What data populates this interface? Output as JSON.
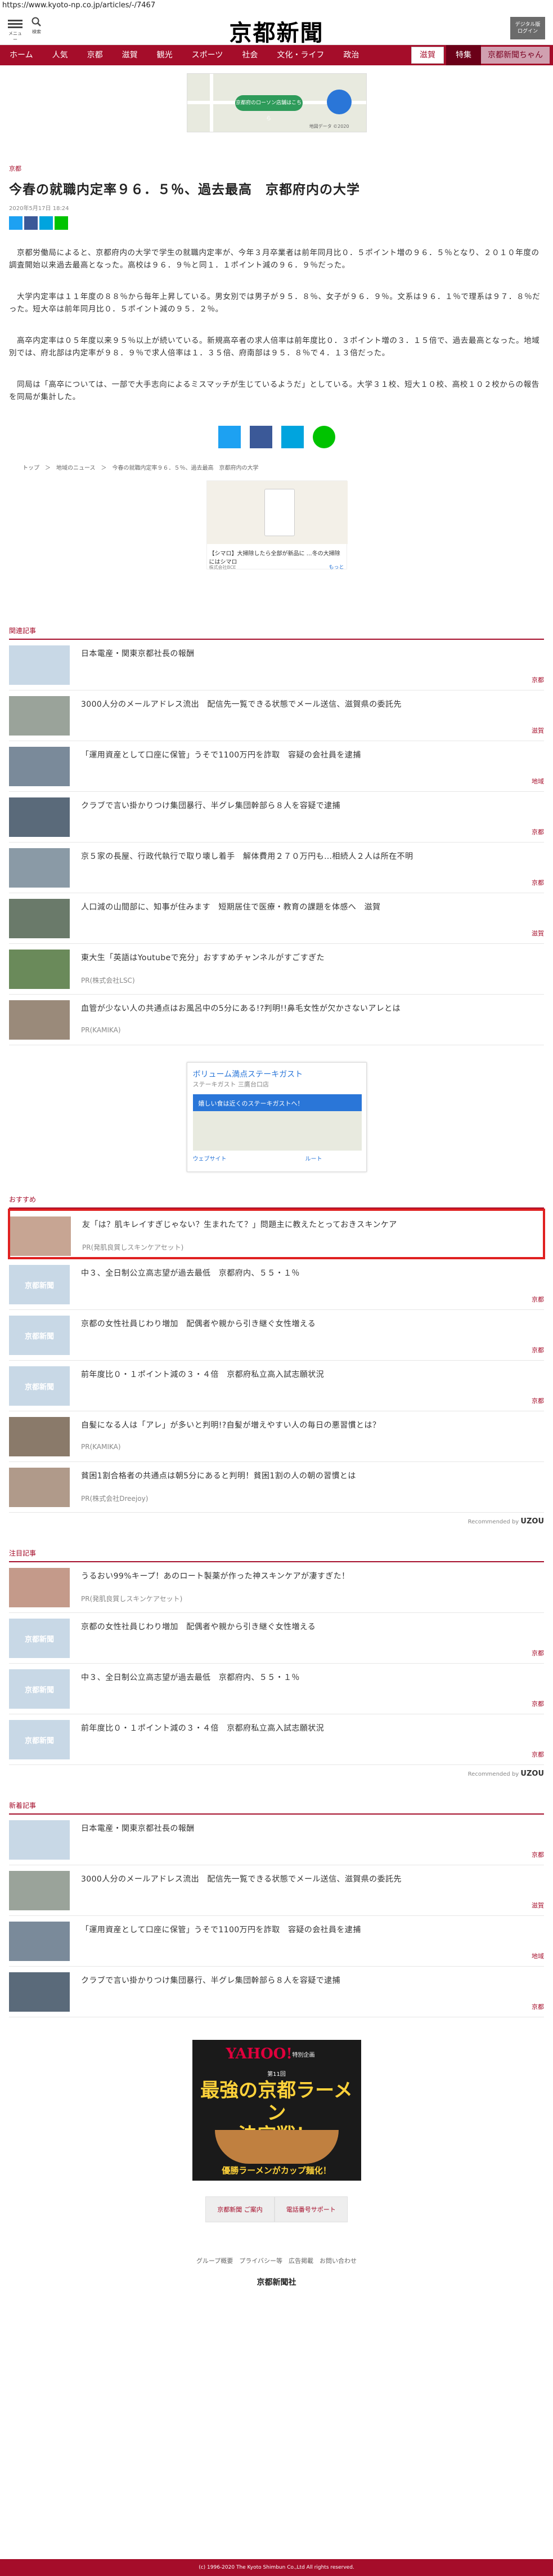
{
  "url": "https://www.kyoto-np.co.jp/articles/-/7467",
  "header": {
    "menu_label": "メニュー",
    "search_label": "検索",
    "logo": "京都新聞",
    "digital_line1": "デジタル版",
    "digital_line2": "ログイン"
  },
  "nav": {
    "items": [
      "ホーム",
      "人気",
      "京都",
      "滋賀",
      "観光",
      "スポーツ",
      "社会",
      "文化・ライフ",
      "政治"
    ],
    "special1": "滋賀",
    "special2": "特集",
    "special3": "京都新聞ちゃん"
  },
  "top_ad": {
    "button": "京都府のローソン店舗はこちら",
    "credit": "地図データ ©2020"
  },
  "article": {
    "category": "京都",
    "title": "今春の就職内定率９６．５％、過去最高　京都府内の大学",
    "date": "2020年5月17日 18:24",
    "paragraphs": [
      "　京都労働局によると、京都府内の大学で学生の就職内定率が、今年３月卒業者は前年同月比０．５ポイント増の９６．５％となり、２０１０年度の調査開始以来過去最高となった。高校は９６．９％と同１．１ポイント減の９６．９％だった。",
      "　大学内定率は１１年度の８８％から毎年上昇している。男女別では男子が９５．８％、女子が９６．９％。文系は９６．１％で理系は９７．８％だった。短大卒は前年同月比０．５ポイント減の９５．２％。",
      "　高卒内定率は０５年度以来９５％以上が続いている。新規高卒者の求人倍率は前年度比０．３ポイント増の３．１５倍で、過去最高となった。地域別では、府北部は内定率が９８．９％で求人倍率は１．３５倍、府南部は９５．８％で４．１３倍だった。",
      "　同局は「高卒については、一部で大手志向によるミスマッチが生じているようだ」としている。大学３１校、短大１０校、高校１０２校からの報告を同局が集計した。"
    ]
  },
  "breadcrumb": "トップ　＞　地域のニュース　＞　今春の就職内定率９６．５％、過去最高　京都府内の大学",
  "ad2": {
    "caption": "【シマロ】大掃除したら全部が新品に\n…冬の大掃除にはシマロ",
    "source": "株式会社BCE",
    "more": "もっと"
  },
  "related": {
    "heading": "関連記事",
    "items": [
      {
        "title": "日本電産・関東京都社長の報酬",
        "cat": "京都"
      },
      {
        "title": "3000人分のメールアドレス流出　配信先一覧できる状態でメール送信、滋賀県の委託先",
        "cat": "滋賀"
      },
      {
        "title": "「運用資産として口座に保管」うそで1100万円を詐取　容疑の会社員を逮捕",
        "cat": "地域"
      },
      {
        "title": "クラブで言い掛かりつけ集団暴行、半グレ集団幹部ら８人を容疑で逮捕",
        "cat": "京都"
      },
      {
        "title": "京５家の長屋、行政代執行で取り壊し着手　解体費用２７０万円も…相続人２人は所在不明",
        "cat": "京都"
      },
      {
        "title": "人口減の山間部に、知事が住みます　短期居住で医療・教育の課題を体感へ　滋賀",
        "cat": "滋賀"
      },
      {
        "title": "東大生「英語はYoutubeで充分」おすすめチャンネルがすごすぎた",
        "pr": "PR(株式会社LSC)"
      },
      {
        "title": "血管が少ない人の共通点はお風呂中の5分にある!?判明!!鼻毛女性が欠かさないアレとは",
        "pr": "PR(KAMIKA)"
      }
    ]
  },
  "map_ad": {
    "title": "ボリューム満点ステーキガスト",
    "subtitle": "ステーキガスト 三鷹台口店",
    "bar": "嬉しい食は近くのステーキガストへ！",
    "b1": "ウェブサイト",
    "b2": "ルート"
  },
  "recommend": {
    "heading": "おすすめ",
    "by": "Recommended by",
    "brand": "UZOU",
    "items": [
      {
        "title": "友「は？肌キレイすぎじゃない？生まれたて？」問題主に教えたとっておきスキンケア",
        "pr": "PR(発肌良質しスキンケアセット)"
      },
      {
        "title": "中３、全日制公立高志望が過去最低　京都府内、５５・１％",
        "cat": "京都"
      },
      {
        "title": "京都の女性社員じわり増加　配偶者や親から引き継ぐ女性増える",
        "cat": "京都"
      },
      {
        "title": "前年度比０・１ポイント減の３・４倍　京都府私立高入試志願状況",
        "cat": "京都"
      },
      {
        "title": "自髪になる人は「アレ」が多いと判明!?自髪が増えやすい人の毎日の悪習慣とは？",
        "pr": "PR(KAMIKA)"
      },
      {
        "title": "貧困1割合格者の共通点は朝5分にあると判明！貧困1割の人の朝の習慣とは",
        "pr": "PR(株式会社Dreejoy)"
      }
    ]
  },
  "attention": {
    "heading": "注目記事",
    "items": [
      {
        "title": "うるおい99%キープ！あのロート製薬が作った神スキンケアが凄すぎた！",
        "pr": "PR(発肌良質しスキンケアセット)"
      },
      {
        "title": "京都の女性社員じわり増加　配偶者や親から引き継ぐ女性増える",
        "cat": "京都"
      },
      {
        "title": "中３、全日制公立高志望が過去最低　京都府内、５５・１％",
        "cat": "京都"
      },
      {
        "title": "前年度比０・１ポイント減の３・４倍　京都府私立高入試志願状況",
        "cat": "京都"
      }
    ]
  },
  "newest": {
    "heading": "新着記事",
    "items": [
      {
        "title": "日本電産・関東京都社長の報酬",
        "cat": "京都"
      },
      {
        "title": "3000人分のメールアドレス流出　配信先一覧できる状態でメール送信、滋賀県の委託先",
        "cat": "滋賀"
      },
      {
        "title": "「運用資産として口座に保管」うそで1100万円を詐取　容疑の会社員を逮捕",
        "cat": "地域"
      },
      {
        "title": "クラブで言い掛かりつけ集団暴行、半グレ集団幹部ら８人を容疑で逮捕",
        "cat": "京都"
      }
    ]
  },
  "ad3": {
    "brand": "YAHOO!",
    "brand2": "特別企画",
    "sub": "第11回",
    "main": "最強の京都ラーメン\n決定戦！",
    "bottom": "優勝ラーメンがカップ麺化！"
  },
  "footer": {
    "btn1": "京都新聞 ご案内",
    "btn2": "電話番号サポート",
    "nav": "グループ概要　プライバシー等　広告掲載　お問い合わせ",
    "logo": "京都新聞社",
    "copyright": "(c) 1996-2020 The Kyoto Shimbun Co.,Ltd All rights reserved."
  },
  "colors": {
    "brand": "#a50d2a",
    "twitter": "#1da1f2",
    "facebook": "#3b5998",
    "hatena": "#00a4de",
    "line": "#00c300",
    "highlight": "#e02020"
  }
}
